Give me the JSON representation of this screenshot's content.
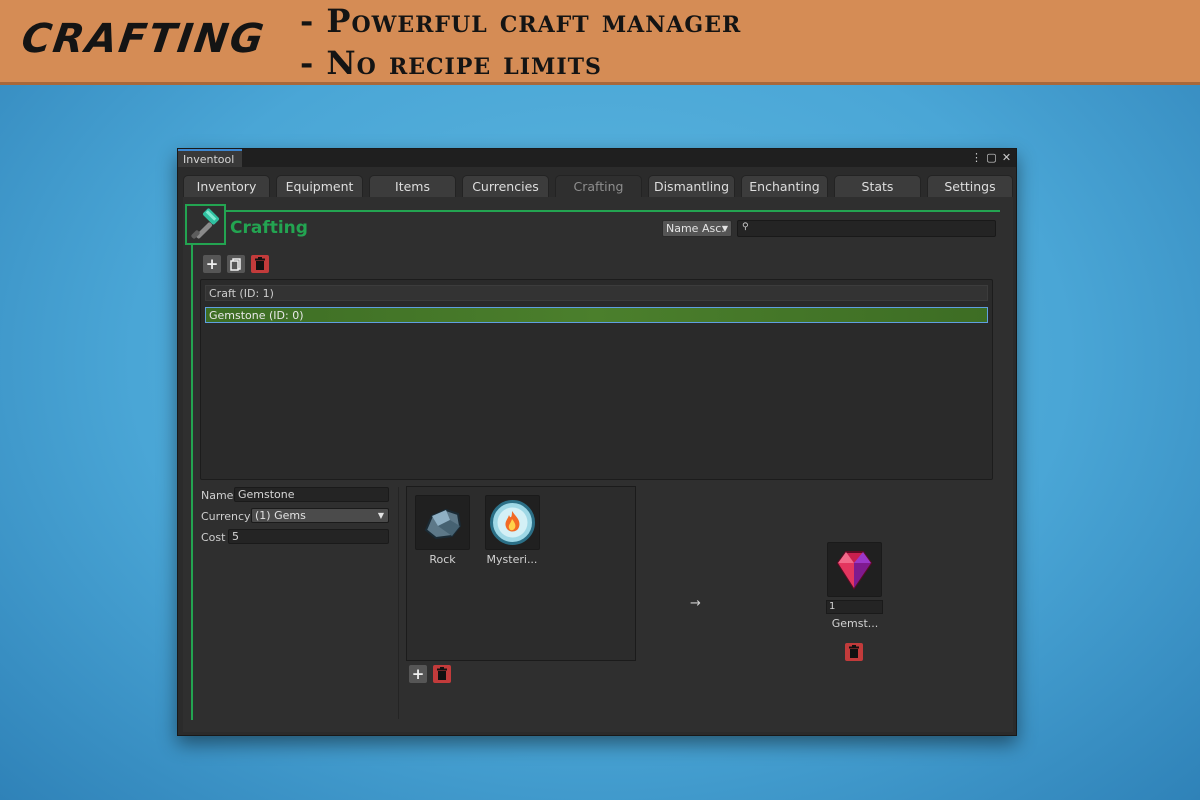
{
  "banner": {
    "title": "CRAFTING",
    "line1": "- Powerful craft manager",
    "line2": "- No recipe limits"
  },
  "window": {
    "tab_label": "Inventool",
    "controls": {
      "menu": "⋮",
      "maximize": "▢",
      "close": "✕"
    }
  },
  "tabs": [
    {
      "label": "Inventory"
    },
    {
      "label": "Equipment"
    },
    {
      "label": "Items"
    },
    {
      "label": "Currencies"
    },
    {
      "label": "Crafting",
      "active": true
    },
    {
      "label": "Dismantling"
    },
    {
      "label": "Enchanting"
    },
    {
      "label": "Stats"
    },
    {
      "label": "Settings"
    }
  ],
  "section": {
    "title": "Crafting",
    "icon": "hammer-icon",
    "sort_label": "Name Asc.",
    "search_placeholder": ""
  },
  "toolbar": {
    "add": "+",
    "duplicate": "⎘",
    "delete": "🗑"
  },
  "list": {
    "rows": [
      {
        "label": "Craft (ID: 1)"
      },
      {
        "label": "Gemstone (ID: 0)",
        "selected": true
      }
    ]
  },
  "details": {
    "name_label": "Name",
    "name_value": "Gemstone",
    "currency_label": "Currency",
    "currency_value": "(1) Gems",
    "cost_label": "Cost",
    "cost_value": "5"
  },
  "ingredients": [
    {
      "label": "Rock",
      "icon": "rock-icon"
    },
    {
      "label": "Mysteri...",
      "icon": "fire-orb-icon"
    }
  ],
  "result": {
    "label": "Gemst...",
    "icon": "gem-icon",
    "quantity": "1",
    "arrow": "→"
  },
  "colors": {
    "accent": "#23a451",
    "delete": "#c23b3b",
    "selection_border": "#5f9fe0",
    "banner": "#d58c55"
  }
}
